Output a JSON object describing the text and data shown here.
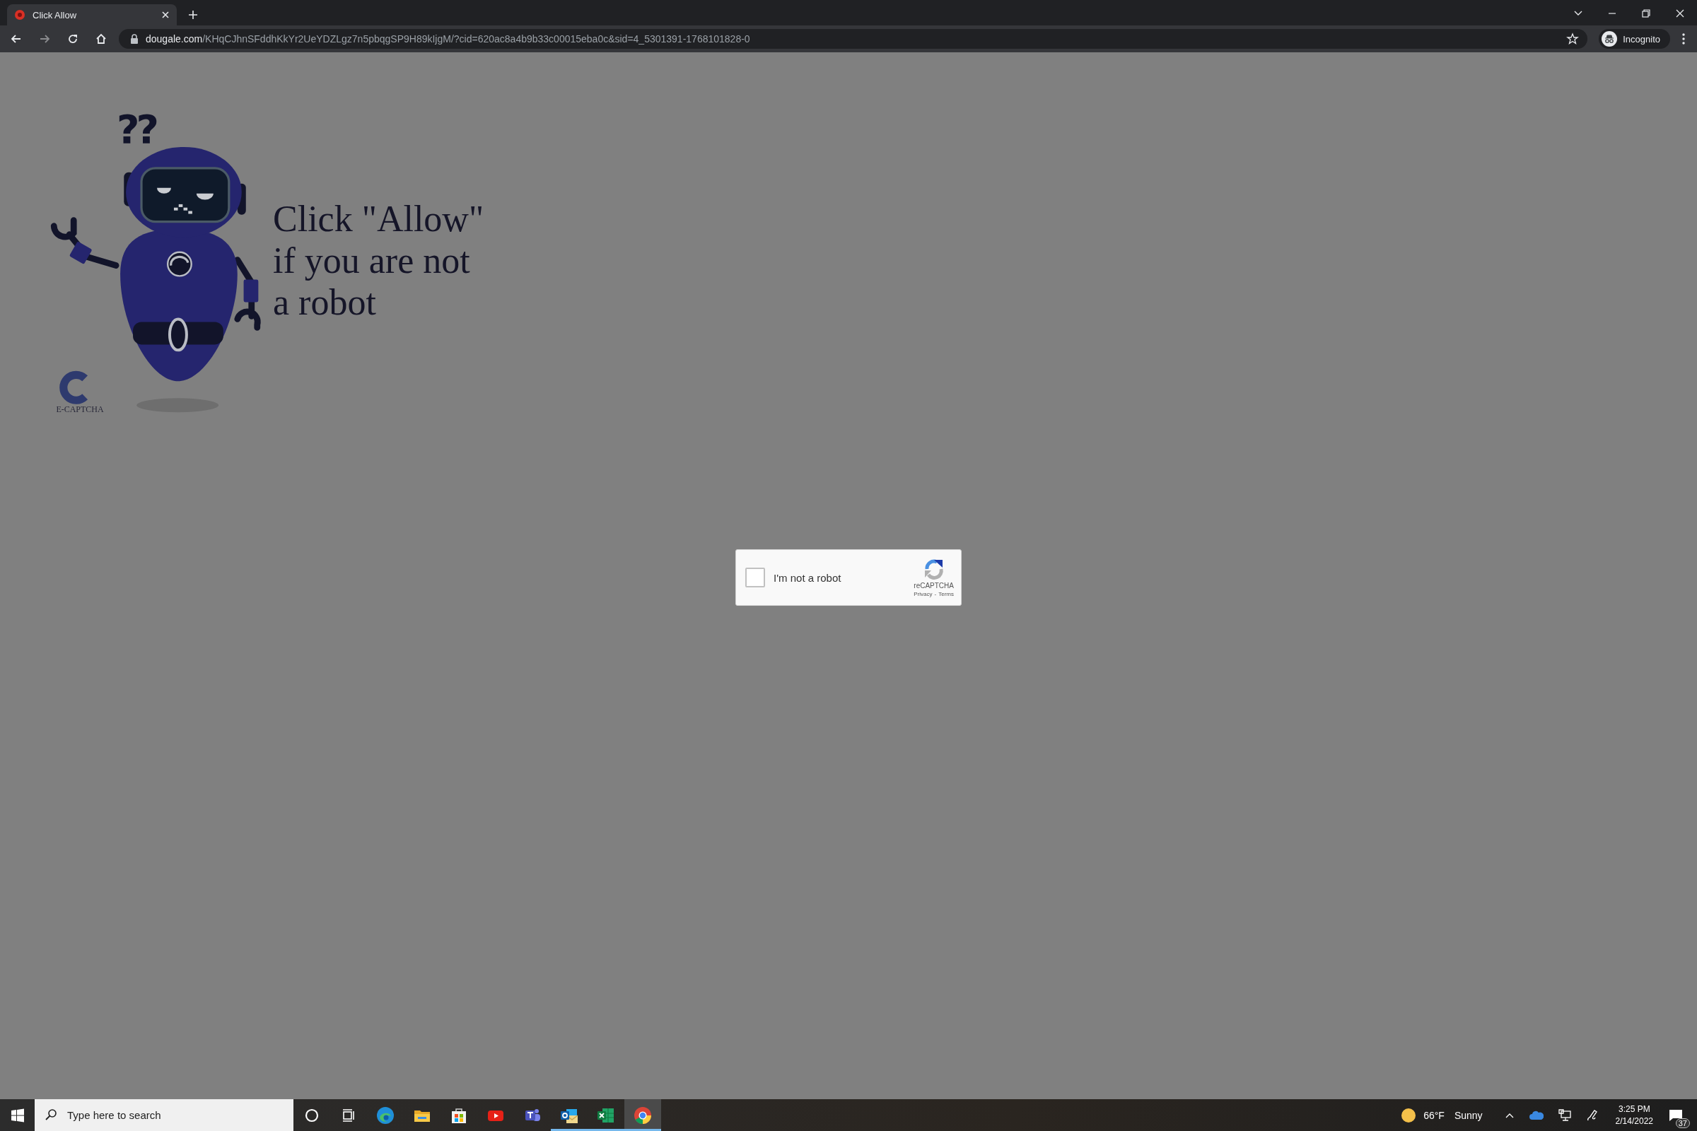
{
  "browser": {
    "tabs": [
      {
        "title": "Click Allow",
        "selected": true
      }
    ],
    "address": {
      "domain": "dougale.com",
      "path": "/KHqCJhnSFddhKkYr2UeYDZLgz7n5pbqgSP9H89kIjgM/?cid=620ac8a4b9b33c00015eba0c&sid=4_5301391-1768101828-0"
    },
    "profile": {
      "label": "Incognito"
    }
  },
  "page": {
    "illustration": {
      "marks": "??",
      "logo_text": "E-CAPTCHA"
    },
    "heading_lines": [
      "Click \"Allow\"",
      "if you are not",
      "a robot"
    ],
    "captcha": {
      "label": "I'm not a robot",
      "checked": false,
      "brand": "reCAPTCHA",
      "links": [
        "Privacy",
        "Terms"
      ],
      "separator": "-"
    }
  },
  "taskbar": {
    "search": {
      "placeholder": "Type here to search"
    },
    "apps": [
      {
        "kind": "cortana",
        "running": false,
        "selected": false
      },
      {
        "kind": "taskview",
        "running": false,
        "selected": false
      },
      {
        "kind": "edge",
        "running": false,
        "selected": false
      },
      {
        "kind": "explorer",
        "running": false,
        "selected": false
      },
      {
        "kind": "store",
        "running": false,
        "selected": false
      },
      {
        "kind": "youtube",
        "running": false,
        "selected": false
      },
      {
        "kind": "teams",
        "running": false,
        "selected": false
      },
      {
        "kind": "outlook",
        "running": true,
        "selected": false
      },
      {
        "kind": "excel",
        "running": true,
        "selected": false
      },
      {
        "kind": "chrome",
        "running": true,
        "selected": true
      }
    ],
    "weather": {
      "temperature": "66°F",
      "condition": "Sunny"
    },
    "clock": {
      "time": "3:25 PM",
      "date": "2/14/2022"
    },
    "notifications": {
      "count": "37"
    }
  }
}
